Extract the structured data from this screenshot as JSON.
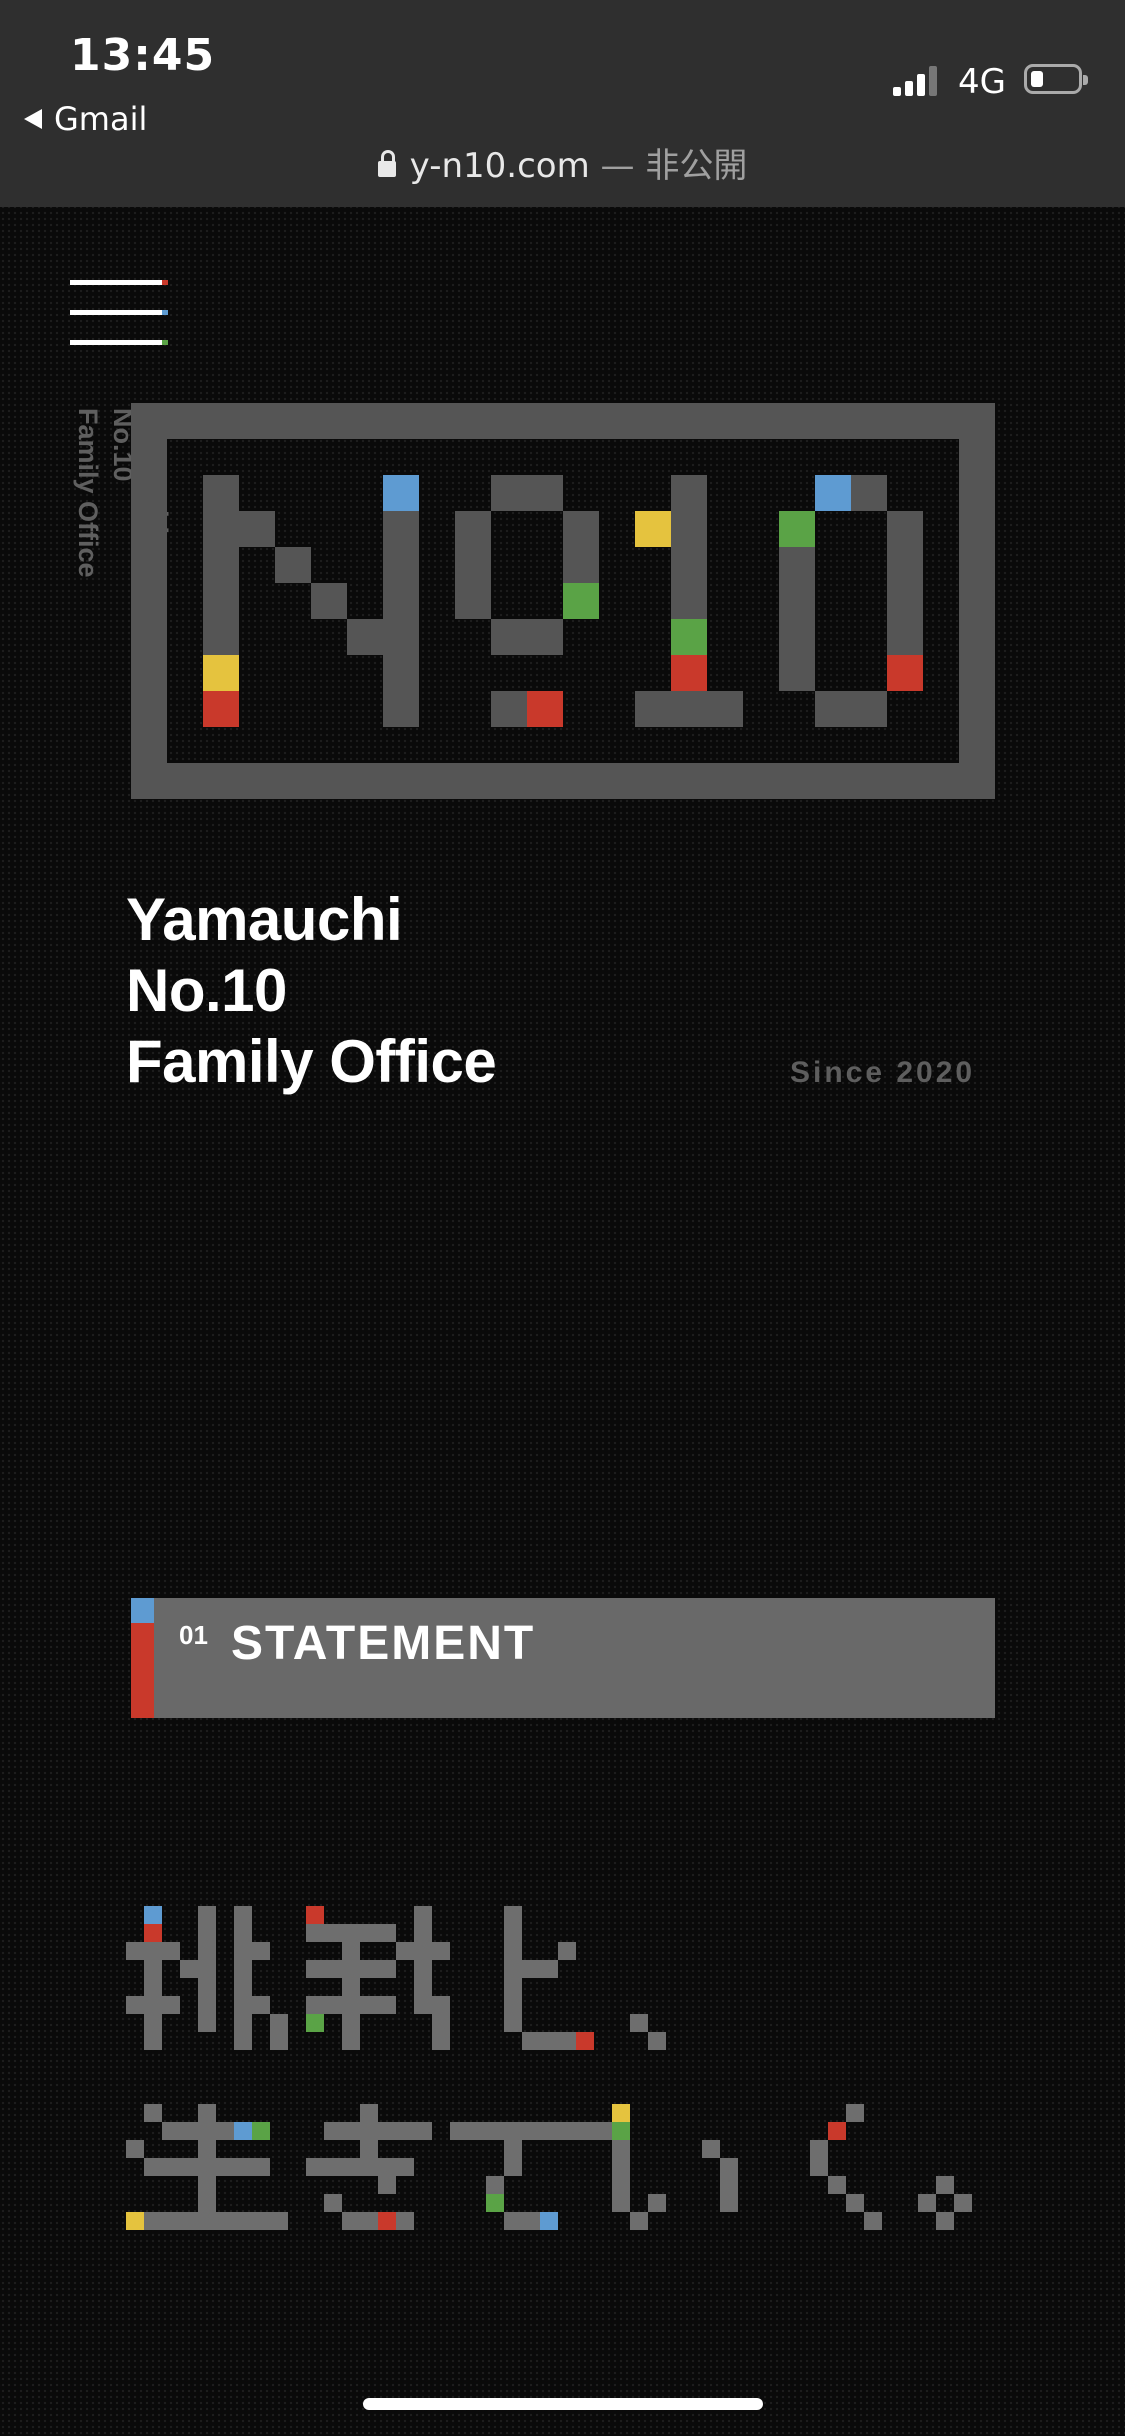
{
  "status_bar": {
    "time": "13:45",
    "back_label": "Gmail",
    "network": "4G",
    "url": "y-n10.com",
    "url_suffix": " — 非公開"
  },
  "menu_icon": "hamburger-icon",
  "side_name": [
    "Yamauchi",
    "No.10",
    "Family Office"
  ],
  "logo_text": "N010",
  "brand": {
    "line1": "Yamauchi",
    "line2": "No.10",
    "line3": "Family Office",
    "since": "Since 2020"
  },
  "statement": {
    "number": "01",
    "title": "STATEMENT"
  },
  "pixel_heading": {
    "line1": "挑戦と、",
    "line2": "生きていく。"
  },
  "colors": {
    "background": "#0a0a0a",
    "gray": "#555555",
    "red": "#c9392b",
    "blue": "#5e9bd2",
    "yellow": "#e5c33e",
    "green": "#5aa346"
  }
}
